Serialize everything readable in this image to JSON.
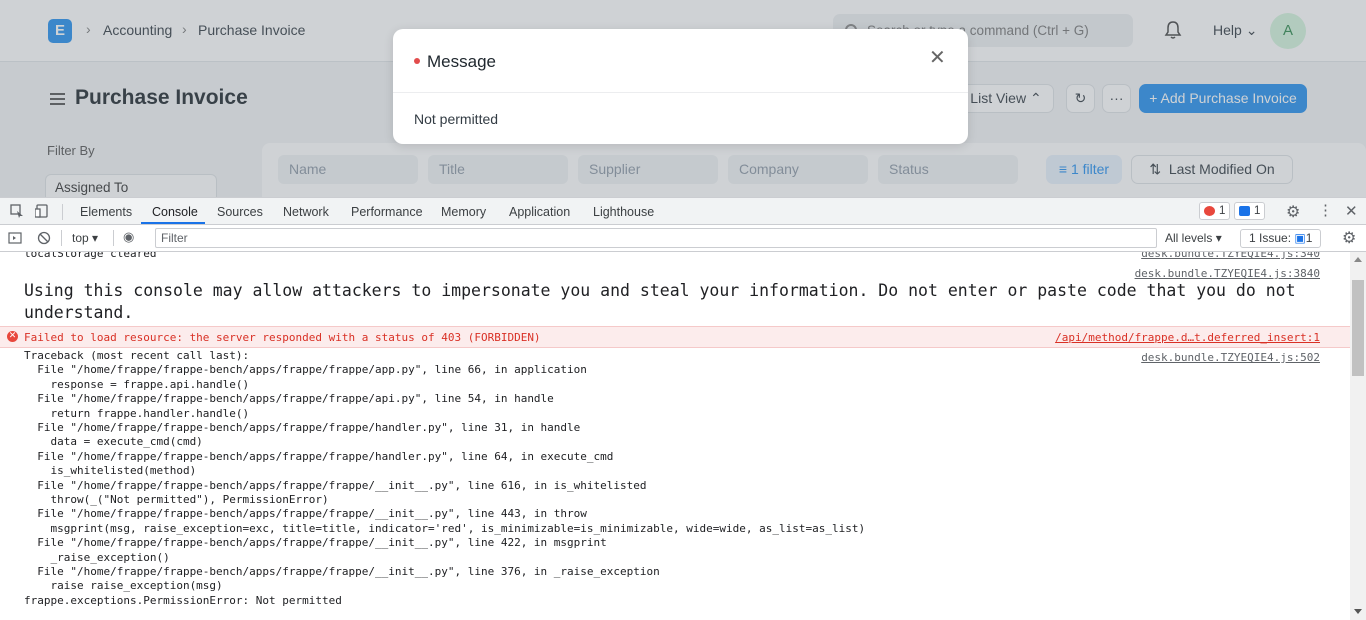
{
  "app": {
    "logo": "E",
    "breadcrumbs": [
      "Accounting",
      "Purchase Invoice"
    ],
    "search_placeholder": "Search or type a command (Ctrl + G)",
    "help_label": "Help",
    "avatar_initial": "A",
    "page_title": "Purchase Invoice",
    "list_view_label": "List View",
    "add_button_label": "+ Add Purchase Invoice",
    "filter_by_label": "Filter By",
    "assigned_to_label": "Assigned To",
    "filter_fields": [
      "Name",
      "Title",
      "Supplier",
      "Company",
      "Status"
    ],
    "filter_count_label": "1 filter",
    "sort_label": "Last Modified On"
  },
  "modal": {
    "title": "Message",
    "body": "Not permitted",
    "indicator_color": "#e24c4c"
  },
  "devtools": {
    "tabs": [
      "Elements",
      "Console",
      "Sources",
      "Network",
      "Performance",
      "Memory",
      "Application",
      "Lighthouse"
    ],
    "active_tab": "Console",
    "error_count": "1",
    "message_count": "1",
    "context": "top",
    "filter_placeholder": "Filter",
    "levels_label": "All levels",
    "issues_label": "1 Issue:",
    "issues_count": "1"
  },
  "console": {
    "line1_text": "localStorage cleared",
    "line1_src": "desk.bundle.TZYEQIE4.js:340",
    "line2_src": "desk.bundle.TZYEQIE4.js:3840",
    "warning": "Using this console may allow attackers to impersonate you and steal your information. Do not enter or paste code that you do not understand.",
    "error_text": "Failed to load resource: the server responded with a status of 403 (FORBIDDEN)",
    "error_src": "/api/method/frappe.d…t.deferred_insert:1",
    "traceback_src": "desk.bundle.TZYEQIE4.js:502",
    "traceback": [
      "Traceback (most recent call last):",
      "  File \"/home/frappe/frappe-bench/apps/frappe/frappe/app.py\", line 66, in application",
      "    response = frappe.api.handle()",
      "  File \"/home/frappe/frappe-bench/apps/frappe/frappe/api.py\", line 54, in handle",
      "    return frappe.handler.handle()",
      "  File \"/home/frappe/frappe-bench/apps/frappe/frappe/handler.py\", line 31, in handle",
      "    data = execute_cmd(cmd)",
      "  File \"/home/frappe/frappe-bench/apps/frappe/frappe/handler.py\", line 64, in execute_cmd",
      "    is_whitelisted(method)",
      "  File \"/home/frappe/frappe-bench/apps/frappe/frappe/__init__.py\", line 616, in is_whitelisted",
      "    throw(_(\"Not permitted\"), PermissionError)",
      "  File \"/home/frappe/frappe-bench/apps/frappe/frappe/__init__.py\", line 443, in throw",
      "    msgprint(msg, raise_exception=exc, title=title, indicator='red', is_minimizable=is_minimizable, wide=wide, as_list=as_list)",
      "  File \"/home/frappe/frappe-bench/apps/frappe/frappe/__init__.py\", line 422, in msgprint",
      "    _raise_exception()",
      "  File \"/home/frappe/frappe-bench/apps/frappe/frappe/__init__.py\", line 376, in _raise_exception",
      "    raise raise_exception(msg)",
      "frappe.exceptions.PermissionError: Not permitted"
    ]
  }
}
